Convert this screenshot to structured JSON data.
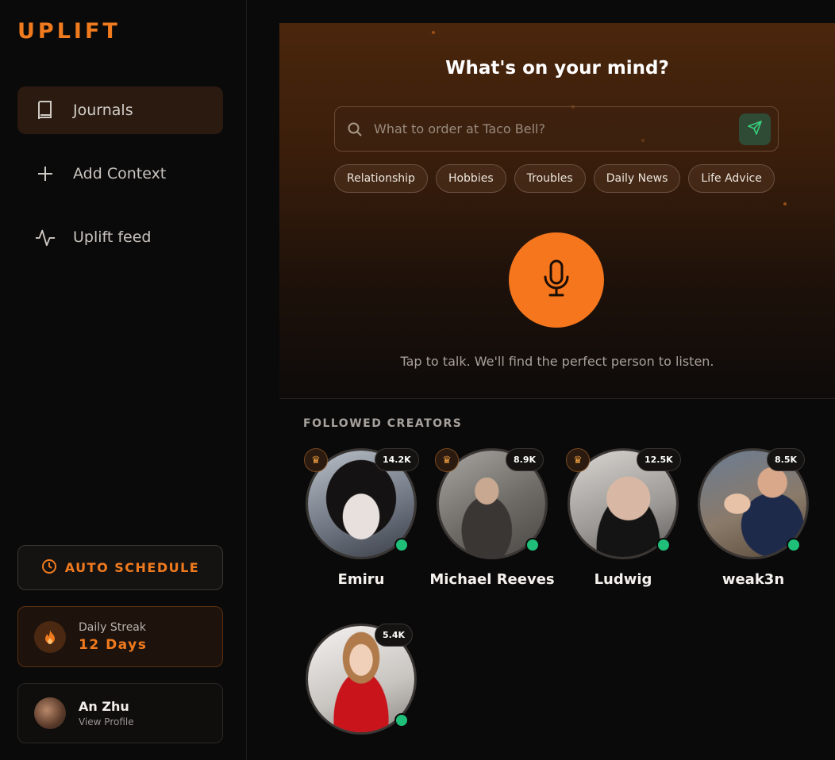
{
  "brand": {
    "logo": "UPLIFT"
  },
  "sidebar": {
    "items": [
      {
        "label": "Journals",
        "icon": "book-icon",
        "active": true
      },
      {
        "label": "Add Context",
        "icon": "plus-icon",
        "active": false
      },
      {
        "label": "Uplift feed",
        "icon": "activity-icon",
        "active": false
      }
    ],
    "auto_schedule": {
      "label": "AUTO SCHEDULE",
      "icon": "clock-icon"
    },
    "streak": {
      "label": "Daily Streak",
      "value": "12 Days",
      "icon": "flame-icon"
    },
    "profile": {
      "name": "An Zhu",
      "sub": "View Profile"
    }
  },
  "hero": {
    "title": "What's on your mind?",
    "search": {
      "placeholder": "What to order at Taco Bell?",
      "value": ""
    },
    "chips": [
      "Relationship",
      "Hobbies",
      "Troubles",
      "Daily News",
      "Life Advice"
    ],
    "hint": "Tap to talk. We'll find the perfect person to listen."
  },
  "creators": {
    "title": "FOLLOWED CREATORS",
    "items": [
      {
        "name": "Emiru",
        "count": "14.2K",
        "crown": true,
        "online": true
      },
      {
        "name": "Michael Reeves",
        "count": "8.9K",
        "crown": true,
        "online": true
      },
      {
        "name": "Ludwig",
        "count": "12.5K",
        "crown": true,
        "online": true
      },
      {
        "name": "weak3n",
        "count": "8.5K",
        "crown": false,
        "online": true
      },
      {
        "name": "",
        "count": "5.4K",
        "crown": false,
        "online": true
      }
    ]
  },
  "colors": {
    "accent": "#f07a1e",
    "online": "#1fbf7a",
    "send": "#2f4a35"
  }
}
